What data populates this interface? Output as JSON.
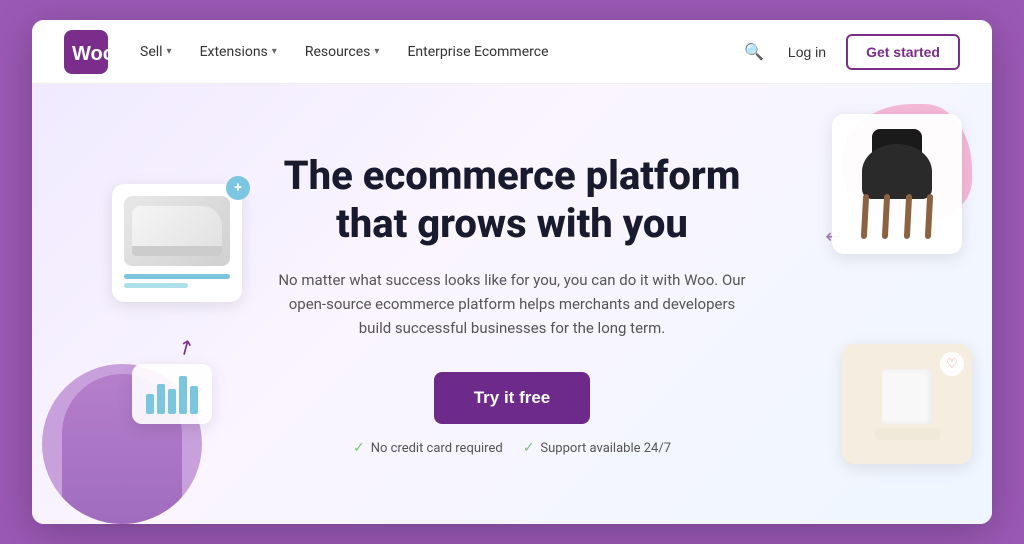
{
  "brand": {
    "name": "Woo",
    "logo_alt": "WooCommerce logo"
  },
  "nav": {
    "links": [
      {
        "label": "Sell",
        "has_dropdown": true
      },
      {
        "label": "Extensions",
        "has_dropdown": true
      },
      {
        "label": "Resources",
        "has_dropdown": true
      },
      {
        "label": "Enterprise Ecommerce",
        "has_dropdown": false
      }
    ],
    "login_label": "Log in",
    "get_started_label": "Get started",
    "search_placeholder": "Search"
  },
  "hero": {
    "title": "The ecommerce platform that grows with you",
    "subtitle": "No matter what success looks like for you, you can do it with Woo. Our open-source ecommerce platform helps merchants and developers build successful businesses for the long term.",
    "cta_label": "Try it free",
    "trust": [
      {
        "text": "No credit card required"
      },
      {
        "text": "Support available 24/7"
      }
    ]
  }
}
